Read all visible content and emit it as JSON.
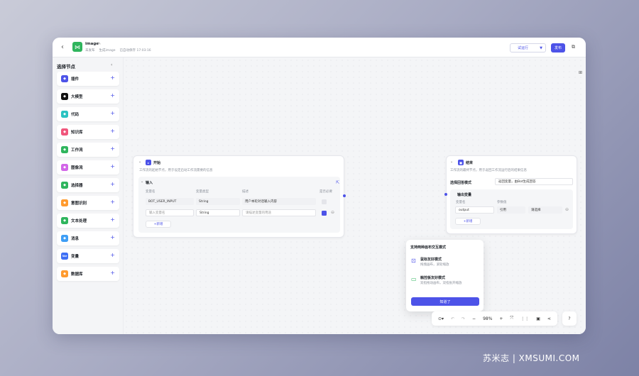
{
  "header": {
    "back_icon": "arrow-left-icon",
    "app_icon": "share-nodes-icon",
    "title": "image",
    "edit_icon": "edit-icon",
    "meta": [
      "未发布",
      "生成image",
      "已自动保存 17:03:16"
    ],
    "run_label": "试运行",
    "publish_label": "发布",
    "copy_icon": "copy-icon"
  },
  "sidebar": {
    "title": "选择节点",
    "items": [
      {
        "label": "插件",
        "icon": "cube-icon",
        "color": "#4d53e8"
      },
      {
        "label": "大模型",
        "icon": "brain-icon",
        "color": "#111111"
      },
      {
        "label": "代码",
        "icon": "code-icon",
        "color": "#2bc3c2"
      },
      {
        "label": "知识库",
        "icon": "book-icon",
        "color": "#f0567c"
      },
      {
        "label": "工作流",
        "icon": "workflow-icon",
        "color": "#2fb55d"
      },
      {
        "label": "图像流",
        "icon": "image-flow-icon",
        "color": "#d266e8"
      },
      {
        "label": "选择器",
        "icon": "branch-icon",
        "color": "#2fb55d"
      },
      {
        "label": "意图识别",
        "icon": "intent-icon",
        "color": "#ff9b2f"
      },
      {
        "label": "文本处理",
        "icon": "text-icon",
        "color": "#2fb55d"
      },
      {
        "label": "消息",
        "icon": "message-icon",
        "color": "#3e9ef5"
      },
      {
        "label": "变量",
        "icon": "var-icon",
        "color": "#3e6ff5",
        "glyph": "Var"
      },
      {
        "label": "数据库",
        "icon": "database-icon",
        "color": "#ff9b2f"
      }
    ]
  },
  "start_node": {
    "title": "开始",
    "description": "工作流的起始节点，用于设定启动工作流需要的信息",
    "section": "输入",
    "columns": [
      "变量名",
      "变量类型",
      "描述",
      "是否必要"
    ],
    "rows": [
      {
        "name": "BOT_USER_INPUT",
        "type": "String",
        "desc": "用户本轮对话输入内容"
      },
      {
        "name": "输入变量名",
        "type": "String",
        "desc": "请描述变量的用途"
      }
    ],
    "add_label": "新增"
  },
  "end_node": {
    "title": "结束",
    "description": "工作流的最终节点，用于返回工作流运行后的结果信息",
    "mode_label": "选择回答模式",
    "mode_value": "返回变量，由Bot生成回答",
    "section": "输出变量",
    "columns": [
      "变量名",
      "参数值"
    ],
    "row": {
      "name": "output",
      "type": "引用",
      "value": "请选择"
    },
    "add_label": "新增"
  },
  "popover": {
    "title": "支持两种画布交互模式",
    "mouse_title": "鼠标友好模式",
    "mouse_desc": "拖拽画布，滚轮缩放",
    "pad_title": "触控板友好模式",
    "pad_desc": "双指拖动画布，双指张开缩放",
    "confirm": "知道了"
  },
  "toolbar": {
    "zoom": "98%"
  },
  "watermark": "苏米志 | XMSUMI.COM"
}
